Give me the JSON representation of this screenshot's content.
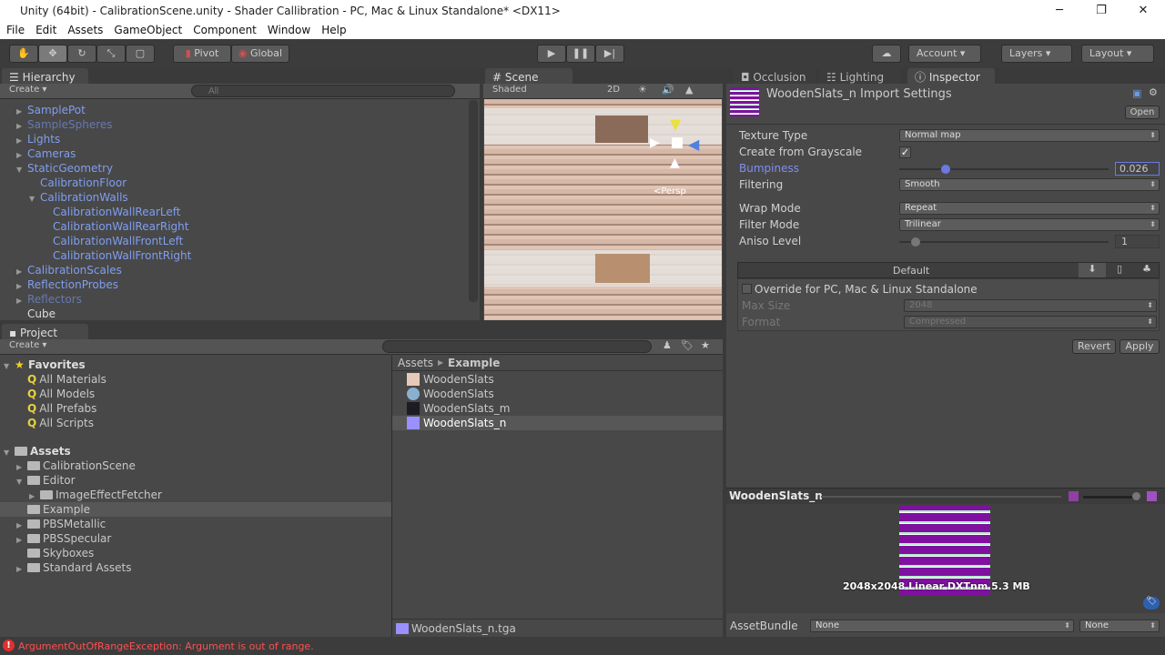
{
  "window": {
    "title": "Unity (64bit) - CalibrationScene.unity - Shader Callibration - PC, Mac & Linux Standalone* <DX11>",
    "minimize": "─",
    "maximize": "❐",
    "close": "✕"
  },
  "menu": [
    "File",
    "Edit",
    "Assets",
    "GameObject",
    "Component",
    "Window",
    "Help"
  ],
  "toolbar": {
    "pivot": "Pivot",
    "global": "Global",
    "account": "Account",
    "layers": "Layers",
    "layout": "Layout"
  },
  "hierarchy": {
    "tab": "Hierarchy",
    "create": "Create",
    "search_placeholder": "All",
    "items": [
      {
        "label": "SamplePot",
        "depth": 0,
        "arrow": "▶",
        "style": "blue"
      },
      {
        "label": "SampleSpheres",
        "depth": 0,
        "arrow": "▶",
        "style": "dimblue"
      },
      {
        "label": "Lights",
        "depth": 0,
        "arrow": "▶",
        "style": "blue"
      },
      {
        "label": "Cameras",
        "depth": 0,
        "arrow": "▶",
        "style": "blue"
      },
      {
        "label": "StaticGeometry",
        "depth": 0,
        "arrow": "▼",
        "style": "blue"
      },
      {
        "label": "CalibrationFloor",
        "depth": 1,
        "arrow": "",
        "style": "blue"
      },
      {
        "label": "CalibrationWalls",
        "depth": 1,
        "arrow": "▼",
        "style": "blue"
      },
      {
        "label": "CalibrationWallRearLeft",
        "depth": 2,
        "arrow": "",
        "style": "blue"
      },
      {
        "label": "CalibrationWallRearRight",
        "depth": 2,
        "arrow": "",
        "style": "blue"
      },
      {
        "label": "CalibrationWallFrontLeft",
        "depth": 2,
        "arrow": "",
        "style": "blue"
      },
      {
        "label": "CalibrationWallFrontRight",
        "depth": 2,
        "arrow": "",
        "style": "blue"
      },
      {
        "label": "CalibrationScales",
        "depth": 0,
        "arrow": "▶",
        "style": "blue"
      },
      {
        "label": "ReflectionProbes",
        "depth": 0,
        "arrow": "▶",
        "style": "blue"
      },
      {
        "label": "Reflectors",
        "depth": 0,
        "arrow": "▶",
        "style": "dimblue"
      },
      {
        "label": "Cube",
        "depth": 0,
        "arrow": "",
        "style": "plain"
      }
    ]
  },
  "scene": {
    "tab": "Scene",
    "shading": "Shaded",
    "mode_2d": "2D",
    "persp": "<Persp"
  },
  "project": {
    "tab": "Project",
    "create": "Create",
    "favorites": {
      "label": "Favorites",
      "items": [
        "All Materials",
        "All Models",
        "All Prefabs",
        "All Scripts"
      ]
    },
    "assets": {
      "label": "Assets",
      "items": [
        {
          "label": "CalibrationScene",
          "depth": 1,
          "arrow": "▶"
        },
        {
          "label": "Editor",
          "depth": 1,
          "arrow": "▼"
        },
        {
          "label": "ImageEffectFetcher",
          "depth": 2,
          "arrow": "▶"
        },
        {
          "label": "Example",
          "depth": 1,
          "arrow": "",
          "selected": true
        },
        {
          "label": "PBSMetallic",
          "depth": 1,
          "arrow": "▶"
        },
        {
          "label": "PBSSpecular",
          "depth": 1,
          "arrow": "▶"
        },
        {
          "label": "Skyboxes",
          "depth": 1,
          "arrow": ""
        },
        {
          "label": "Standard Assets",
          "depth": 1,
          "arrow": "▶"
        }
      ]
    },
    "breadcrumb": [
      "Assets",
      "Example"
    ],
    "files": [
      {
        "label": "WoodenSlats",
        "icon": "texture",
        "color": "#e8c8b8"
      },
      {
        "label": "WoodenSlats",
        "icon": "material-sphere",
        "color": "#8ab0d0"
      },
      {
        "label": "WoodenSlats_m",
        "icon": "texture",
        "color": "#1c1c22"
      },
      {
        "label": "WoodenSlats_n",
        "icon": "texture",
        "color": "#9a90ff",
        "selected": true
      }
    ],
    "status_file": "WoodenSlats_n.tga"
  },
  "inspector": {
    "tabs": [
      "Occlusion",
      "Lighting",
      "Inspector"
    ],
    "title": "WoodenSlats_n Import Settings",
    "open": "Open",
    "fields": {
      "texture_type": {
        "label": "Texture Type",
        "value": "Normal map"
      },
      "grayscale": {
        "label": "Create from Grayscale",
        "checked": true
      },
      "bumpiness": {
        "label": "Bumpiness",
        "value": "0.026",
        "slider_fraction": 0.026
      },
      "filtering": {
        "label": "Filtering",
        "value": "Smooth"
      },
      "wrap": {
        "label": "Wrap Mode",
        "value": "Repeat"
      },
      "filter": {
        "label": "Filter Mode",
        "value": "Trilinear"
      },
      "aniso": {
        "label": "Aniso Level",
        "value": "1"
      }
    },
    "platform": {
      "default": "Default",
      "override": "Override for PC, Mac & Linux Standalone",
      "max_size_label": "Max Size",
      "max_size": "2048",
      "format_label": "Format",
      "format": "Compressed"
    },
    "revert": "Revert",
    "apply": "Apply"
  },
  "preview": {
    "title": "WoodenSlats_n",
    "info": "2048x2048 Linear  DXTnm   5.3 MB",
    "assetbundle_label": "AssetBundle",
    "bundle": "None",
    "variant": "None"
  },
  "status": {
    "error": "ArgumentOutOfRangeException: Argument is out of range.",
    "color": "#ff5050"
  }
}
